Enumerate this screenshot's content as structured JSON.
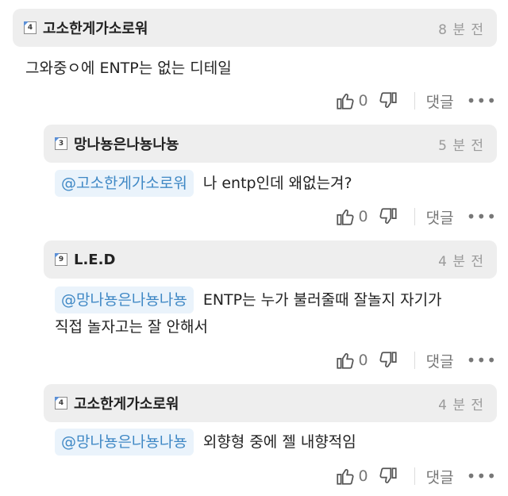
{
  "comments": [
    {
      "level": "4",
      "nickname": "고소한게가소로워",
      "time": "8 분 전",
      "mention": "",
      "text": "그와중ㅇ에 ENTP는 없는 디테일",
      "likes": "0",
      "reply_label": "댓글",
      "more_label": "•••"
    },
    {
      "level": "3",
      "nickname": "망나뇽은나뇽나뇽",
      "time": "5 분 전",
      "mention": "@고소한게가소로워",
      "text": "나 entp인데 왜없는겨?",
      "likes": "0",
      "reply_label": "댓글",
      "more_label": "•••"
    },
    {
      "level": "9",
      "nickname": "L.E.D",
      "time": "4 분 전",
      "mention": "@망나뇽은나뇽나뇽",
      "text": "ENTP는 누가 불러줄때 잘놀지 자기가",
      "text2": "직접 놀자고는 잘 안해서",
      "likes": "0",
      "reply_label": "댓글",
      "more_label": "•••"
    },
    {
      "level": "4",
      "nickname": "고소한게가소로워",
      "time": "4 분 전",
      "mention": "@망나뇽은나뇽나뇽",
      "text": "외향형 중에 젤 내향적임",
      "likes": "0",
      "reply_label": "댓글",
      "more_label": "•••"
    }
  ]
}
